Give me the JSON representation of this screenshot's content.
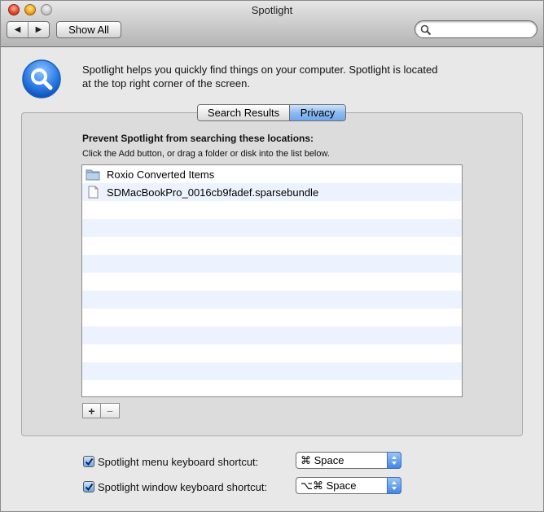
{
  "window": {
    "title": "Spotlight"
  },
  "toolbar": {
    "back_icon": "◀",
    "forward_icon": "▶",
    "show_all_label": "Show All",
    "search_value": ""
  },
  "intro": {
    "icon": "spotlight-magnifier-icon",
    "text_line1": "Spotlight helps you quickly find things on your computer. Spotlight is located",
    "text_line2": "at the top right corner of the screen."
  },
  "tabs": [
    {
      "label": "Search Results",
      "selected": false
    },
    {
      "label": "Privacy",
      "selected": true
    }
  ],
  "privacy": {
    "heading": "Prevent Spotlight from searching these locations:",
    "instructions": "Click the Add button, or drag a folder or disk into the list below.",
    "items": [
      {
        "name": "Roxio Converted Items",
        "icon": "folder-icon"
      },
      {
        "name": "SDMacBookPro_0016cb9fadef.sparsebundle",
        "icon": "document-icon"
      }
    ],
    "add_label": "+",
    "remove_label": "−"
  },
  "shortcuts": {
    "menu": {
      "checked": true,
      "label": "Spotlight menu keyboard shortcut:",
      "value": "⌘ Space"
    },
    "window": {
      "checked": true,
      "label": "Spotlight window keyboard shortcut:",
      "value": "⌥⌘ Space"
    }
  },
  "colors": {
    "accent": "#6ea6ec",
    "stripe": "#edf3fe"
  }
}
